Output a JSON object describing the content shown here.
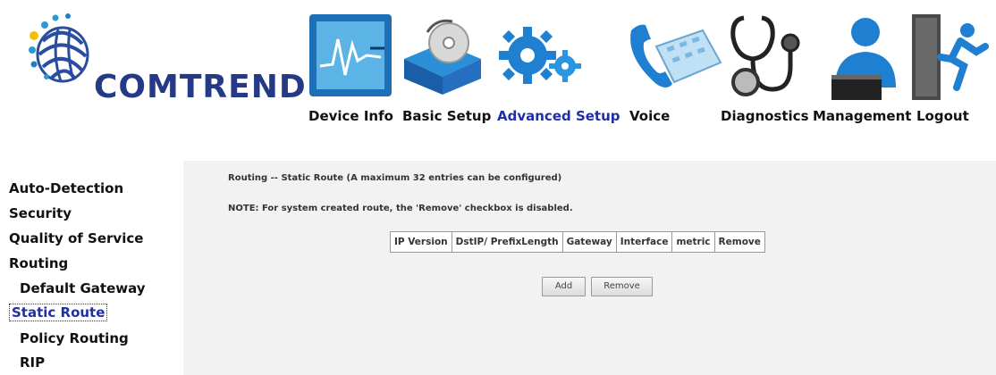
{
  "brand": {
    "name": "COMTREND"
  },
  "nav": [
    {
      "label": "Device Info",
      "icon": "device-info-icon"
    },
    {
      "label": "Basic Setup",
      "icon": "basic-setup-icon"
    },
    {
      "label": "Advanced Setup",
      "icon": "advanced-setup-gears-icon",
      "active": true
    },
    {
      "label": "Voice",
      "icon": "voice-phone-icon"
    },
    {
      "label": "Diagnostics",
      "icon": "stethoscope-icon"
    },
    {
      "label": "Management",
      "icon": "management-person-icon"
    },
    {
      "label": "Logout",
      "icon": "logout-exit-icon"
    }
  ],
  "sidebar": {
    "items": [
      {
        "label": "Auto-Detection"
      },
      {
        "label": "Security"
      },
      {
        "label": "Quality of Service"
      },
      {
        "label": "Routing"
      },
      {
        "label": "Default Gateway",
        "sub": true
      },
      {
        "label": "Static Route",
        "sub": true,
        "selected": true
      },
      {
        "label": "Policy Routing",
        "sub": true
      },
      {
        "label": "RIP",
        "sub": true
      }
    ]
  },
  "main": {
    "title": "Routing -- Static Route (A maximum 32 entries can be configured)",
    "note": "NOTE: For system created route, the 'Remove' checkbox is disabled.",
    "table": {
      "headers": [
        "IP Version",
        "DstIP/ PrefixLength",
        "Gateway",
        "Interface",
        "metric",
        "Remove"
      ],
      "rows": []
    },
    "buttons": {
      "add": "Add",
      "remove": "Remove"
    }
  },
  "colors": {
    "brand": "#243a86",
    "active_link": "#1f2fa6",
    "content_bg": "#f2f2f2"
  }
}
